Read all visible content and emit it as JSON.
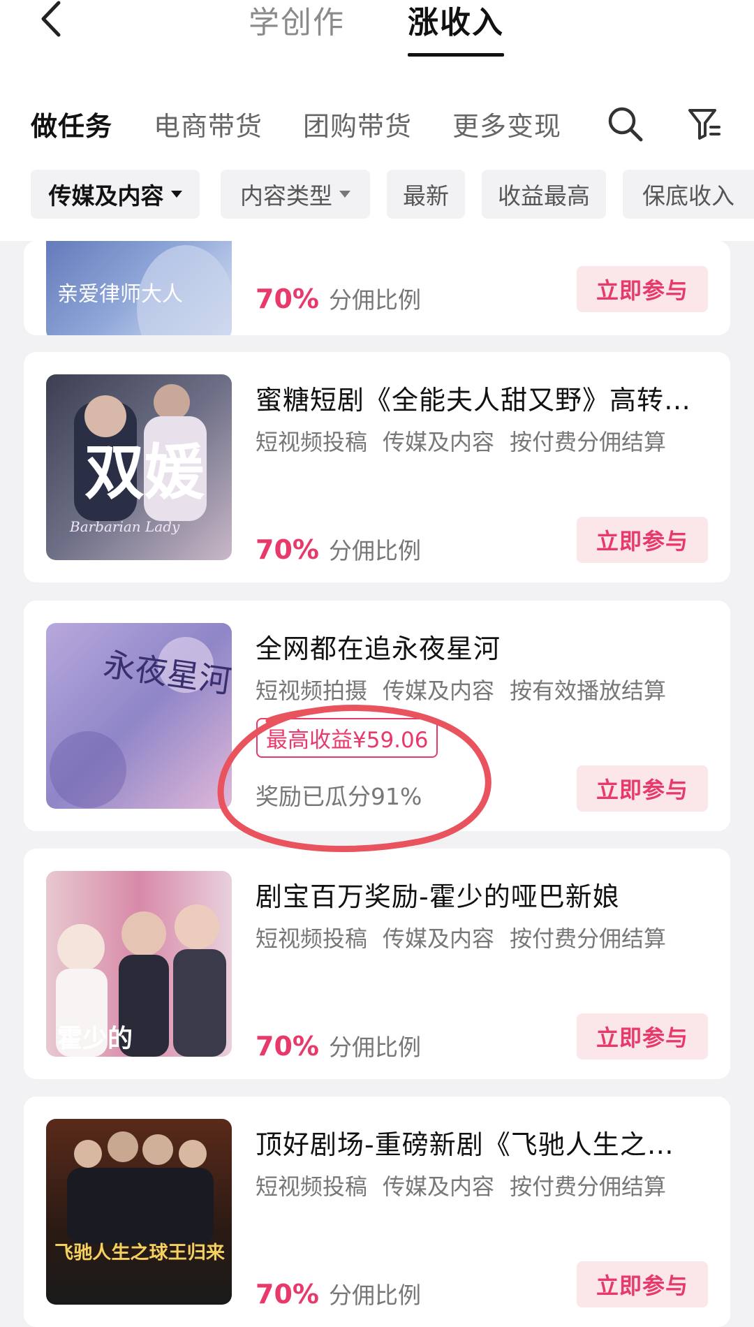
{
  "header": {
    "tabs": [
      {
        "label": "学创作",
        "active": false
      },
      {
        "label": "涨收入",
        "active": true
      }
    ]
  },
  "categories": [
    {
      "label": "做任务",
      "active": true
    },
    {
      "label": "电商带货",
      "active": false
    },
    {
      "label": "团购带货",
      "active": false
    },
    {
      "label": "更多变现",
      "active": false
    }
  ],
  "filters": [
    {
      "label": "传媒及内容",
      "dropdown": true,
      "active": true
    },
    {
      "label": "内容类型",
      "dropdown": true,
      "active": false
    },
    {
      "label": "最新",
      "dropdown": false,
      "active": false
    },
    {
      "label": "收益最高",
      "dropdown": false,
      "active": false
    },
    {
      "label": "保底收入",
      "dropdown": false,
      "active": false
    }
  ],
  "colors": {
    "accent": "#e8396b",
    "button_bg": "#fbe6ea",
    "annotation": "#e8535e"
  },
  "tasks": [
    {
      "title": "",
      "thumb_text": "亲爱律师大人",
      "tags": [],
      "percent": "70%",
      "percent_label": "分佣比例",
      "button": "立即参与"
    },
    {
      "title": "蜜糖短剧《全能夫人甜又野》高转…",
      "thumb_text": "双媛",
      "thumb_subtext": "Barbarian Lady",
      "tags": [
        "短视频投稿",
        "传媒及内容",
        "按付费分佣结算"
      ],
      "percent": "70%",
      "percent_label": "分佣比例",
      "button": "立即参与"
    },
    {
      "title": "全网都在追永夜星河",
      "thumb_text": "永夜星河",
      "tags": [
        "短视频拍摄",
        "传媒及内容",
        "按有效播放结算"
      ],
      "reward_label": "最高收益¥59.06",
      "reward_progress": "奖励已瓜分91%",
      "button": "立即参与"
    },
    {
      "title": "剧宝百万奖励-霍少的哑巴新娘",
      "thumb_text": "霍少的",
      "tags": [
        "短视频投稿",
        "传媒及内容",
        "按付费分佣结算"
      ],
      "percent": "70%",
      "percent_label": "分佣比例",
      "button": "立即参与"
    },
    {
      "title": "顶好剧场-重磅新剧《飞驰人生之…",
      "thumb_text": "飞驰人生之球王归来",
      "tags": [
        "短视频投稿",
        "传媒及内容",
        "按付费分佣结算"
      ],
      "percent": "70%",
      "percent_label": "分佣比例",
      "button": "立即参与"
    }
  ]
}
